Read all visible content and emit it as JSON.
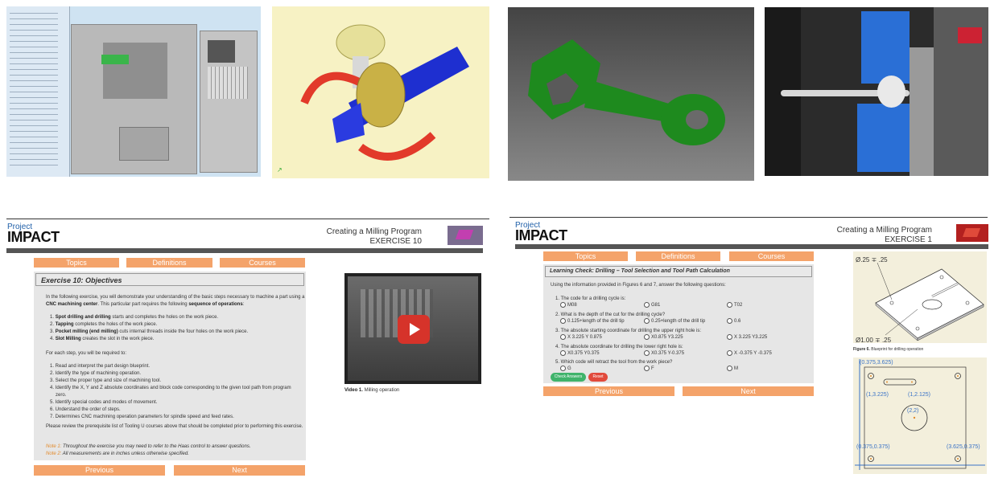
{
  "exercise10": {
    "logo": {
      "project": "Project",
      "impact": "IMPACT"
    },
    "header": {
      "title": "Creating a Milling Program",
      "exercise": "EXERCISE 10"
    },
    "nav": {
      "topics": "Topics",
      "definitions": "Definitions",
      "courses": "Courses"
    },
    "objectives_title": "Exercise 10: Objectives",
    "intro_1": "In the following exercise, you will demonstrate your understanding of the basic steps necessary to machine a part using a",
    "intro_2a": "CNC machining center",
    "intro_2b": ". This particular part requires the following ",
    "intro_2c": "sequence of operations",
    "intro_2d": ":",
    "ops": [
      {
        "num": "1.",
        "bold": "Spot drilling and drilling",
        "rest": " starts and completes the holes on the work piece."
      },
      {
        "num": "2.",
        "bold": "Tapping",
        "rest": " completes the holes of the work piece."
      },
      {
        "num": "3.",
        "bold": "Pocket milling (end milling)",
        "rest": " cuts internal threads inside the four holes on the work piece."
      },
      {
        "num": "4.",
        "bold": "Slot Milling",
        "rest": " creates the slot in the work piece."
      }
    ],
    "for_each": "For each step, you will be required to:",
    "steps": [
      "1. Read and interpret the part design blueprint.",
      "2. Identify the type of machining operation.",
      "3. Select the proper type and size of machining tool.",
      "4. Identify the X, Y and Z absolute coordinates and block code corresponding to the given tool path from program",
      "zero.",
      "5. Identify special codes and modes of movement.",
      "6. Understand the order of steps.",
      "7. Determines CNC machining operation parameters for spindle speed and feed rates."
    ],
    "prereq": "Please review the prerequisite list of Tooling U courses above that should be completed prior to performing this exercise.",
    "note1_label": "Note 1:",
    "note1": " Throughout the exercise you may need to refer to the Haas control to answer questions.",
    "note2_label": "Note 2:",
    "note2": " All measurements are in inches unless otherwise specified.",
    "video_caption_bold": "Video 1.",
    "video_caption": " Milling operation",
    "previous": "Previous",
    "next": "Next"
  },
  "exercise1": {
    "logo": {
      "project": "Project",
      "impact": "IMPACT"
    },
    "header": {
      "title": "Creating a Milling Program",
      "exercise": "EXERCISE 1"
    },
    "nav": {
      "topics": "Topics",
      "definitions": "Definitions",
      "courses": "Courses"
    },
    "lc_title": "Learning Check: Drilling – Tool Selection and Tool Path Calculation",
    "lc_intro": "Using the information provided in Figures 6 and 7, answer the following questions:",
    "questions": [
      {
        "q": "1. The code for a drilling cycle is:",
        "opts": [
          "M08",
          "G81",
          "T02"
        ]
      },
      {
        "q": "2. What is the depth of the cut for the drilling cycle?",
        "opts": [
          "0.125+length of the drill tip",
          "0.25+length of the drill tip",
          "0.6"
        ]
      },
      {
        "q": "3. The absolute starting coordinate for drilling the upper right hole is:",
        "opts": [
          "X 3.225 Y 0.875",
          "X0.875 Y3.225",
          "X 3.225 Y3.225"
        ]
      },
      {
        "q": "4. The absolute coordinate for drilling the lower right hole is:",
        "opts": [
          "X0.375 Y0.375",
          "X0.375 Y-0.375",
          "X -0.375 Y -0.375"
        ]
      },
      {
        "q": "5. Which code will retract the tool from the work piece?",
        "opts": [
          "G",
          "F",
          "M"
        ]
      }
    ],
    "check_answers": "Check Answers",
    "reset": "Reset",
    "previous": "Previous",
    "next": "Next",
    "fig6": {
      "dim_top": "Ø.25 ∓ .25",
      "dim_bottom": "Ø1.00 ∓ .25",
      "caption_bold": "Figure 6.",
      "caption": " Blueprint for drilling operation"
    },
    "fig7": {
      "p1": "(0.375,3.625)",
      "p2": "(1,3.225)",
      "p3": "(1,2.125)",
      "p4": "(2,2)",
      "p5": "(0.375,0.375)",
      "p6": "(3.625,0.375)"
    }
  },
  "colors": {
    "orange": "#f4a36a",
    "grey_panel": "#e6e6e6",
    "green_btn": "#3fb36b",
    "red_btn": "#e14a3c",
    "video_play": "#d6332a"
  }
}
